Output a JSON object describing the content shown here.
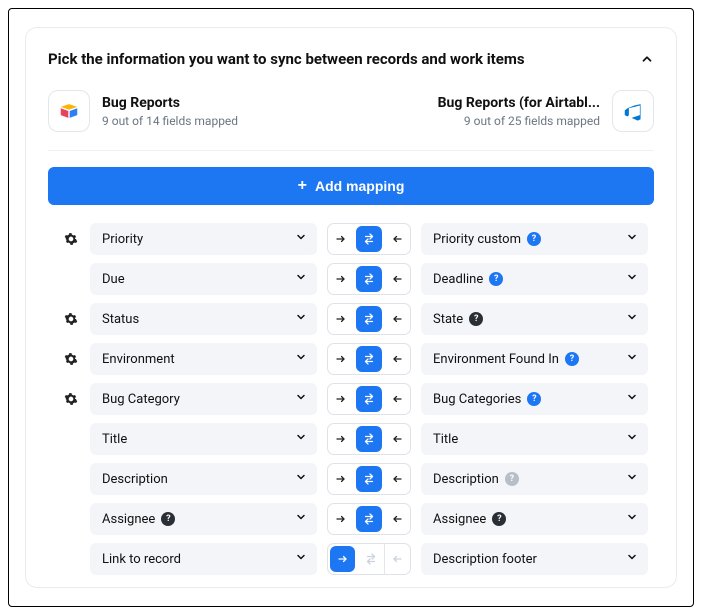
{
  "header": {
    "title": "Pick the information you want to sync between records and work items"
  },
  "sources": {
    "left": {
      "name": "Bug Reports",
      "sub": "9 out of 14 fields mapped"
    },
    "right": {
      "name": "Bug Reports (for Airtabl...",
      "sub": "9 out of 25 fields mapped"
    }
  },
  "addButton": {
    "label": "Add mapping"
  },
  "mappings": [
    {
      "gear": true,
      "left": {
        "label": "Priority"
      },
      "right": {
        "label": "Priority custom",
        "badge": "blue"
      },
      "mode": "both"
    },
    {
      "gear": false,
      "left": {
        "label": "Due"
      },
      "right": {
        "label": "Deadline",
        "badge": "blue"
      },
      "mode": "both"
    },
    {
      "gear": true,
      "left": {
        "label": "Status"
      },
      "right": {
        "label": "State",
        "badge": "dark"
      },
      "mode": "both"
    },
    {
      "gear": true,
      "left": {
        "label": "Environment"
      },
      "right": {
        "label": "Environment Found In",
        "badge": "blue"
      },
      "mode": "both"
    },
    {
      "gear": true,
      "left": {
        "label": "Bug Category"
      },
      "right": {
        "label": "Bug Categories",
        "badge": "blue"
      },
      "mode": "both"
    },
    {
      "gear": false,
      "left": {
        "label": "Title"
      },
      "right": {
        "label": "Title"
      },
      "mode": "both"
    },
    {
      "gear": false,
      "left": {
        "label": "Description"
      },
      "right": {
        "label": "Description",
        "badge": "gray"
      },
      "mode": "both"
    },
    {
      "gear": false,
      "left": {
        "label": "Assignee",
        "badge": "dark"
      },
      "right": {
        "label": "Assignee",
        "badge": "dark"
      },
      "mode": "both"
    },
    {
      "gear": false,
      "left": {
        "label": "Link to record"
      },
      "right": {
        "label": "Description footer"
      },
      "mode": "right"
    }
  ]
}
